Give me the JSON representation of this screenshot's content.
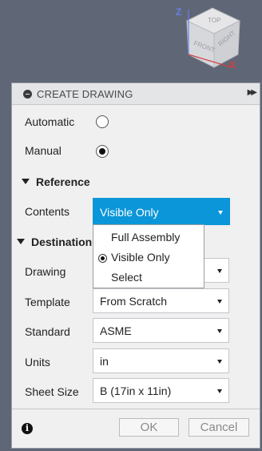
{
  "viewcube": {
    "z_label": "Z",
    "x_label": "X",
    "faces": [
      "TOP",
      "FRONT",
      "RIGHT"
    ]
  },
  "dialog": {
    "title": "CREATE DRAWING",
    "automatic_label": "Automatic",
    "manual_label": "Manual",
    "reference_section": "Reference",
    "contents_label": "Contents",
    "contents_value": "Visible Only",
    "contents_options": [
      "Full Assembly",
      "Visible Only",
      "Select"
    ],
    "destination_section": "Destination",
    "drawing_label": "Drawing",
    "template_label": "Template",
    "template_value": "From Scratch",
    "standard_label": "Standard",
    "standard_value": "ASME",
    "units_label": "Units",
    "units_value": "in",
    "sheet_size_label": "Sheet Size",
    "sheet_size_value": "B (17in x 11in)",
    "ok_label": "OK",
    "cancel_label": "Cancel"
  }
}
